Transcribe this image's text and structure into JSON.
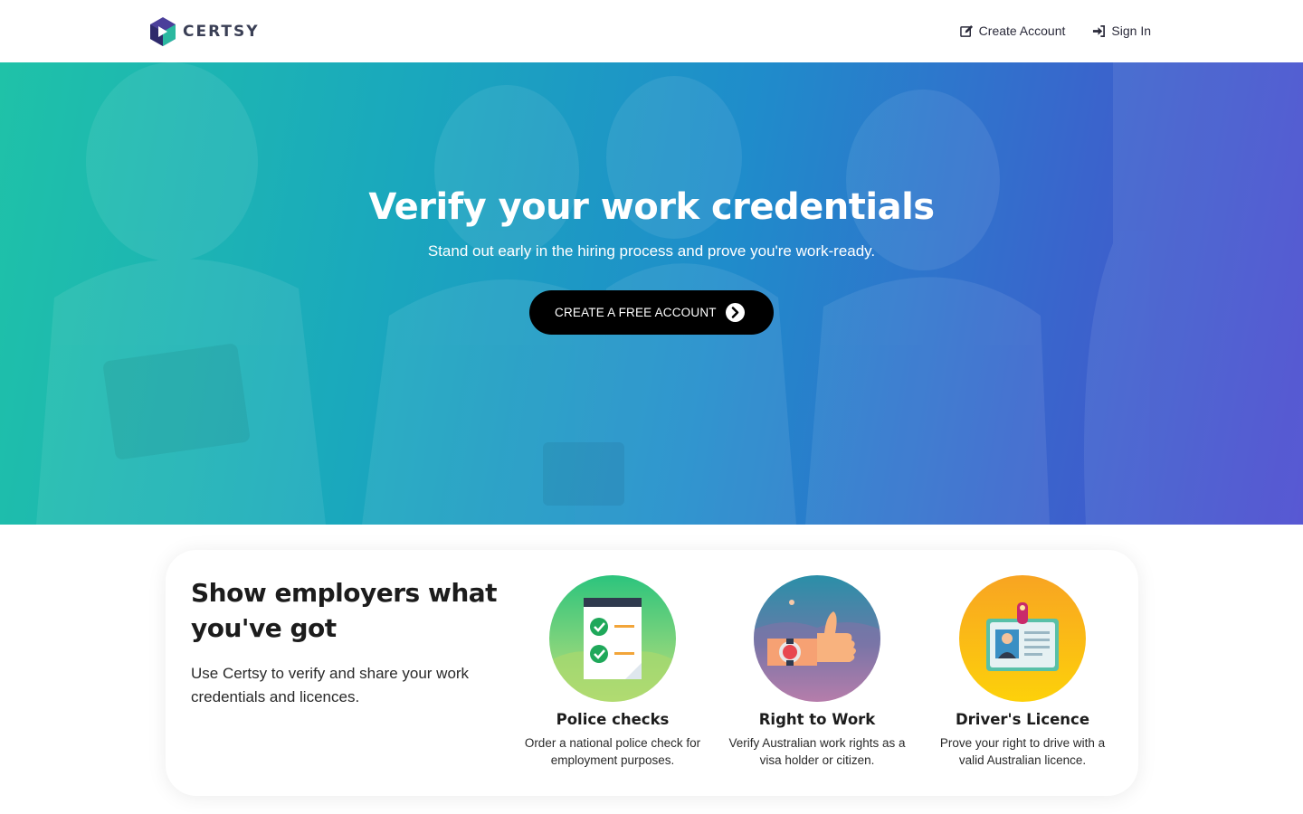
{
  "brand": {
    "name": "CERTSY"
  },
  "nav": {
    "create_account": "Create Account",
    "sign_in": "Sign In"
  },
  "hero": {
    "title": "Verify your work credentials",
    "subtitle": "Stand out early in the hiring process and prove you're work-ready.",
    "cta_label": "CREATE A FREE ACCOUNT"
  },
  "features_card": {
    "title": "Show employers what you've got",
    "text": "Use Certsy to verify and share your work credentials and licences.",
    "items": [
      {
        "title": "Police checks",
        "desc": "Order a national police check for employment purposes.",
        "icon": "checklist-icon"
      },
      {
        "title": "Right to Work",
        "desc": "Verify Australian work rights as a visa holder or citizen.",
        "icon": "thumbs-up-icon"
      },
      {
        "title": "Driver's Licence",
        "desc": "Prove your right to drive with a valid Australian licence.",
        "icon": "id-card-icon"
      }
    ]
  },
  "colors": {
    "hero_start": "#1fc2a8",
    "hero_end": "#4a4ad0",
    "button": "#000000"
  }
}
